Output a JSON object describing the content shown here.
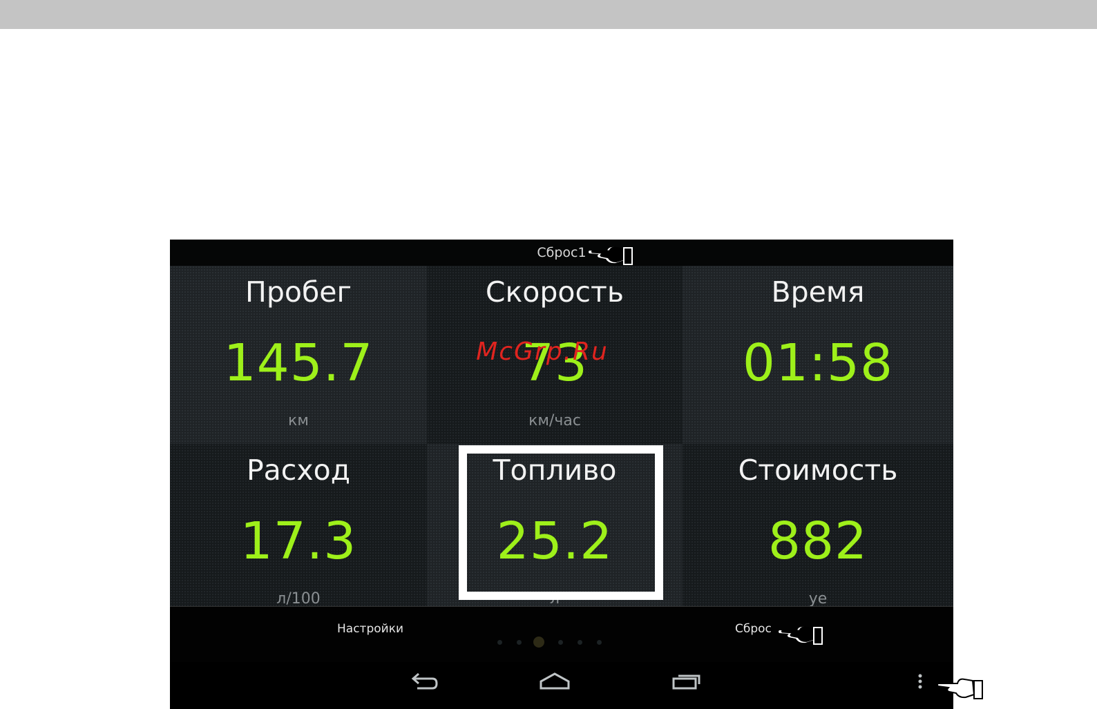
{
  "app": {
    "reset_top_label": "Сброс1"
  },
  "tiles": [
    {
      "title": "Пробег",
      "value": "145.7",
      "unit": "км"
    },
    {
      "title": "Скорость",
      "value": "73",
      "unit": "км/час"
    },
    {
      "title": "Время",
      "value": "01:58",
      "unit": ""
    },
    {
      "title": "Расход",
      "value": "17.3",
      "unit": "л/100"
    },
    {
      "title": "Топливо",
      "value": "25.2",
      "unit": "л"
    },
    {
      "title": "Стоимость",
      "value": "882",
      "unit": "уе"
    }
  ],
  "menu": {
    "settings_label": "Настройки",
    "reset_label": "Сброс"
  },
  "page_indicator": {
    "count": 6,
    "active_index": 2
  },
  "watermark": "McGrp.Ru",
  "icons": {
    "back": "back-icon",
    "home": "home-icon",
    "recents": "recent-apps-icon",
    "overflow": "overflow-menu-icon",
    "pointer": "pointing-hand-icon"
  },
  "colors": {
    "value_green": "#9ef01a",
    "highlight_border": "#ffffff",
    "watermark_red": "#e0241f"
  }
}
